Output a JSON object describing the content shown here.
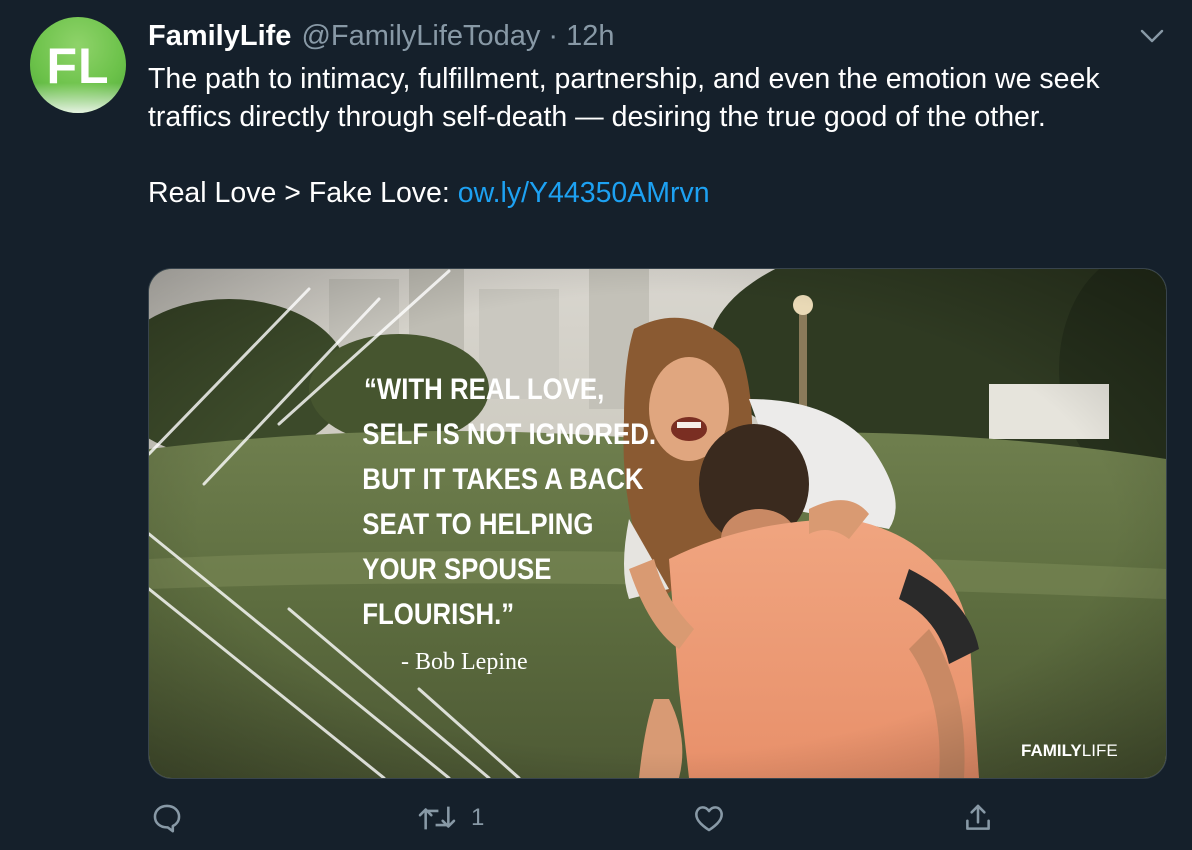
{
  "user": {
    "avatar_initials": "FL",
    "display_name": "FamilyLife",
    "handle": "@FamilyLifeToday",
    "separator": "·",
    "time": "12h"
  },
  "tweet": {
    "text_line1": "The path to intimacy, fulfillment, partnership, and even the emotion we seek traffics directly through self-death — desiring the true good of the other.",
    "text_line2_prefix": "Real Love > Fake Love: ",
    "link": "ow.ly/Y44350AMrvn"
  },
  "media": {
    "quote_lines": [
      "“WITH REAL LOVE,",
      "SELF IS NOT IGNORED.",
      "BUT IT TAKES A BACK",
      "SEAT TO HELPING",
      "YOUR SPOUSE",
      "FLOURISH.”"
    ],
    "attribution": "- Bob Lepine",
    "brand_left": "FAMILY",
    "brand_right": "LIFE"
  },
  "actions": {
    "reply_count": "",
    "retweet_count": "1",
    "like_count": ""
  },
  "colors": {
    "background": "#15202b",
    "secondary_text": "#8899a6",
    "link": "#1da1f2",
    "avatar_green": "#6cc24a"
  },
  "icons": [
    "reply-icon",
    "retweet-icon",
    "like-icon",
    "share-icon",
    "chevron-down-icon"
  ]
}
